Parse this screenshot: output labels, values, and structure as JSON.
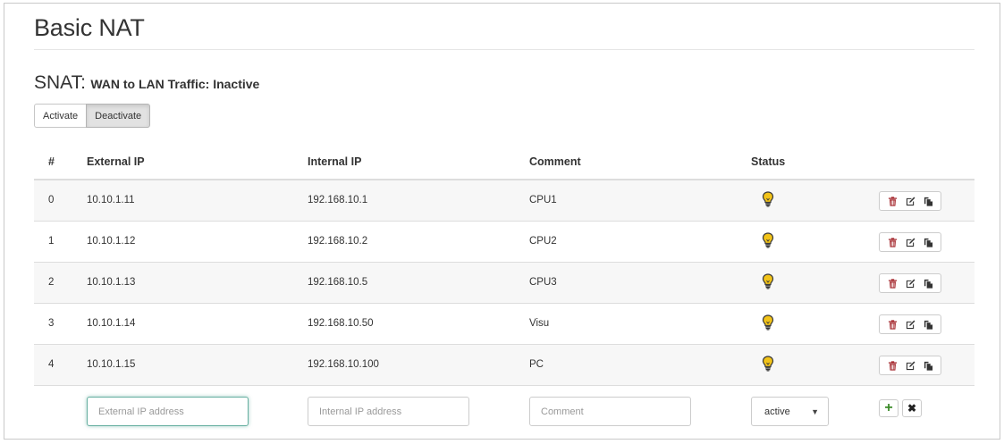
{
  "page": {
    "title": "Basic NAT"
  },
  "snat": {
    "heading": "SNAT:",
    "subheading": "WAN to LAN Traffic: Inactive",
    "activate_label": "Activate",
    "deactivate_label": "Deactivate",
    "active_toggle": "Deactivate"
  },
  "table": {
    "headers": {
      "index": "#",
      "external_ip": "External IP",
      "internal_ip": "Internal IP",
      "comment": "Comment",
      "status": "Status"
    },
    "rows": [
      {
        "index": "0",
        "external_ip": "10.10.1.11",
        "internal_ip": "192.168.10.1",
        "comment": "CPU1",
        "status_icon": "lightbulb-icon"
      },
      {
        "index": "1",
        "external_ip": "10.10.1.12",
        "internal_ip": "192.168.10.2",
        "comment": "CPU2",
        "status_icon": "lightbulb-icon"
      },
      {
        "index": "2",
        "external_ip": "10.10.1.13",
        "internal_ip": "192.168.10.5",
        "comment": "CPU3",
        "status_icon": "lightbulb-icon"
      },
      {
        "index": "3",
        "external_ip": "10.10.1.14",
        "internal_ip": "192.168.10.50",
        "comment": "Visu",
        "status_icon": "lightbulb-icon"
      },
      {
        "index": "4",
        "external_ip": "10.10.1.15",
        "internal_ip": "192.168.10.100",
        "comment": "PC",
        "status_icon": "lightbulb-icon"
      }
    ],
    "row_actions": [
      "trash-icon",
      "edit-icon",
      "copy-icon"
    ]
  },
  "new_entry": {
    "external_ip_placeholder": "External IP address",
    "internal_ip_placeholder": "Internal IP address",
    "comment_placeholder": "Comment",
    "status_selected": "active",
    "add_icon": "plus-icon",
    "cancel_icon": "close-icon"
  },
  "colors": {
    "bulb_fill": "#f2c318",
    "trash": "#a4262c",
    "add": "#3a8a28",
    "focus_border": "#66afa0"
  }
}
